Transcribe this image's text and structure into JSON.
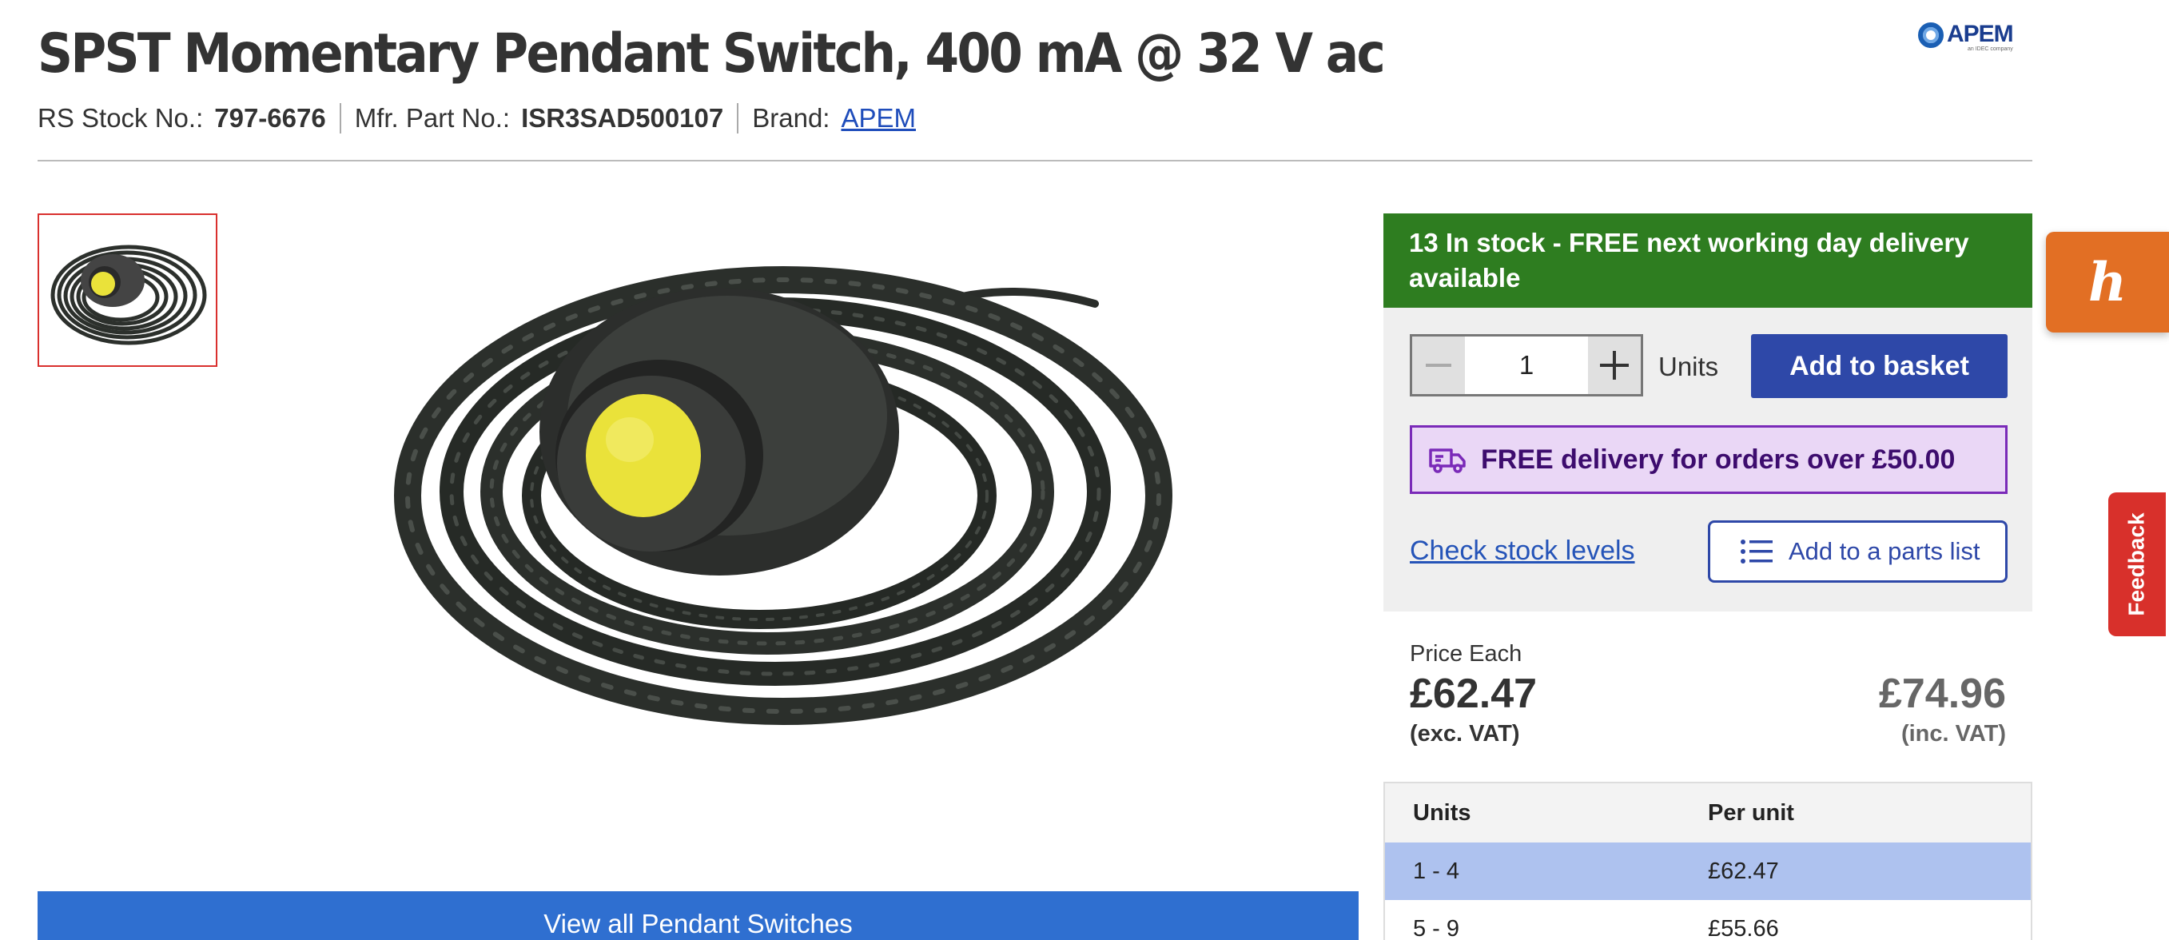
{
  "product": {
    "title": "SPST Momentary Pendant Switch, 400 mA @ 32 V ac",
    "stock_no_label": "RS Stock No.:",
    "stock_no": "797-6676",
    "mfr_part_label": "Mfr. Part No.:",
    "mfr_part": "ISR3SAD500107",
    "brand_label": "Brand:",
    "brand": "APEM"
  },
  "brand_logo": {
    "text": "APEM",
    "tagline": "an IDEC company"
  },
  "gallery": {
    "view_all_label": "View all Pendant Switches"
  },
  "buy_box": {
    "stock_banner": "13 In stock - FREE next working day delivery available",
    "quantity": "1",
    "minus_icon": "minus-icon",
    "plus_icon": "plus-icon",
    "units_label": "Units",
    "add_to_basket": "Add to basket",
    "free_delivery": "FREE delivery for orders over £50.00",
    "check_stock": "Check stock levels",
    "add_parts_list": "Add to a parts list"
  },
  "pricing": {
    "price_each_label": "Price Each",
    "price_ex_vat": "£62.47",
    "ex_vat_label": "(exc. VAT)",
    "price_inc_vat": "£74.96",
    "inc_vat_label": "(inc. VAT)"
  },
  "price_table": {
    "headers": [
      "Units",
      "Per unit"
    ],
    "rows": [
      {
        "units": "1 - 4",
        "per_unit": "£62.47"
      },
      {
        "units": "5 - 9",
        "per_unit": "£55.66"
      }
    ]
  },
  "widgets": {
    "honey": "h",
    "feedback": "Feedback"
  },
  "colors": {
    "stock_green": "#2e7d20",
    "basket_blue": "#2e48a8",
    "delivery_purple": "#7a2ab8",
    "view_all_blue": "#2f6fd0",
    "highlight_row": "#aec2ef",
    "feedback_red": "#d8302b",
    "honey_orange": "#e26f24"
  }
}
